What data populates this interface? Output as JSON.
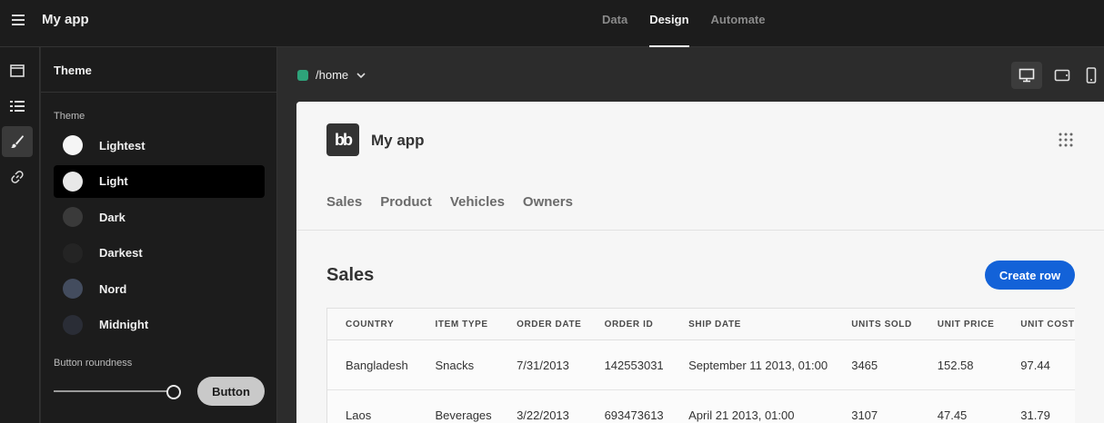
{
  "app": {
    "title": "My app"
  },
  "top_tabs": [
    {
      "label": "Data",
      "active": false
    },
    {
      "label": "Design",
      "active": true
    },
    {
      "label": "Automate",
      "active": false
    }
  ],
  "rail": [
    {
      "icon": "layout-icon",
      "active": false
    },
    {
      "icon": "list-icon",
      "active": false
    },
    {
      "icon": "brush-icon",
      "active": true
    },
    {
      "icon": "link-icon",
      "active": false
    }
  ],
  "panel": {
    "heading": "Theme",
    "theme_label": "Theme",
    "themes": [
      {
        "name": "Lightest",
        "color": "#f5f5f5",
        "selected": false
      },
      {
        "name": "Light",
        "color": "#e8e8e8",
        "selected": true
      },
      {
        "name": "Dark",
        "color": "#3a3a3a",
        "selected": false
      },
      {
        "name": "Darkest",
        "color": "#242424",
        "selected": false
      },
      {
        "name": "Nord",
        "color": "#434c5e",
        "selected": false
      },
      {
        "name": "Midnight",
        "color": "#2a2d36",
        "selected": false
      }
    ],
    "roundness_label": "Button roundness",
    "roundness_value": 1.0,
    "button_preview": "Button"
  },
  "canvas": {
    "route": "/home",
    "route_color": "#2ea37a",
    "devices": [
      {
        "icon": "desktop-icon",
        "active": true
      },
      {
        "icon": "tablet-icon",
        "active": false
      },
      {
        "icon": "mobile-icon",
        "active": false
      }
    ]
  },
  "preview": {
    "logo_text": "bb",
    "title": "My app",
    "nav": [
      "Sales",
      "Product",
      "Vehicles",
      "Owners"
    ],
    "section_title": "Sales",
    "create_button": "Create row",
    "accent": "#1362d8",
    "table": {
      "columns": [
        "COUNTRY",
        "ITEM TYPE",
        "ORDER DATE",
        "ORDER ID",
        "SHIP DATE",
        "UNITS SOLD",
        "UNIT PRICE",
        "UNIT COST"
      ],
      "rows": [
        [
          "Bangladesh",
          "Snacks",
          "7/31/2013",
          "142553031",
          "September 11 2013, 01:00",
          "3465",
          "152.58",
          "97.44"
        ],
        [
          "Laos",
          "Beverages",
          "3/22/2013",
          "693473613",
          "April 21 2013, 01:00",
          "3107",
          "47.45",
          "31.79"
        ]
      ]
    }
  }
}
